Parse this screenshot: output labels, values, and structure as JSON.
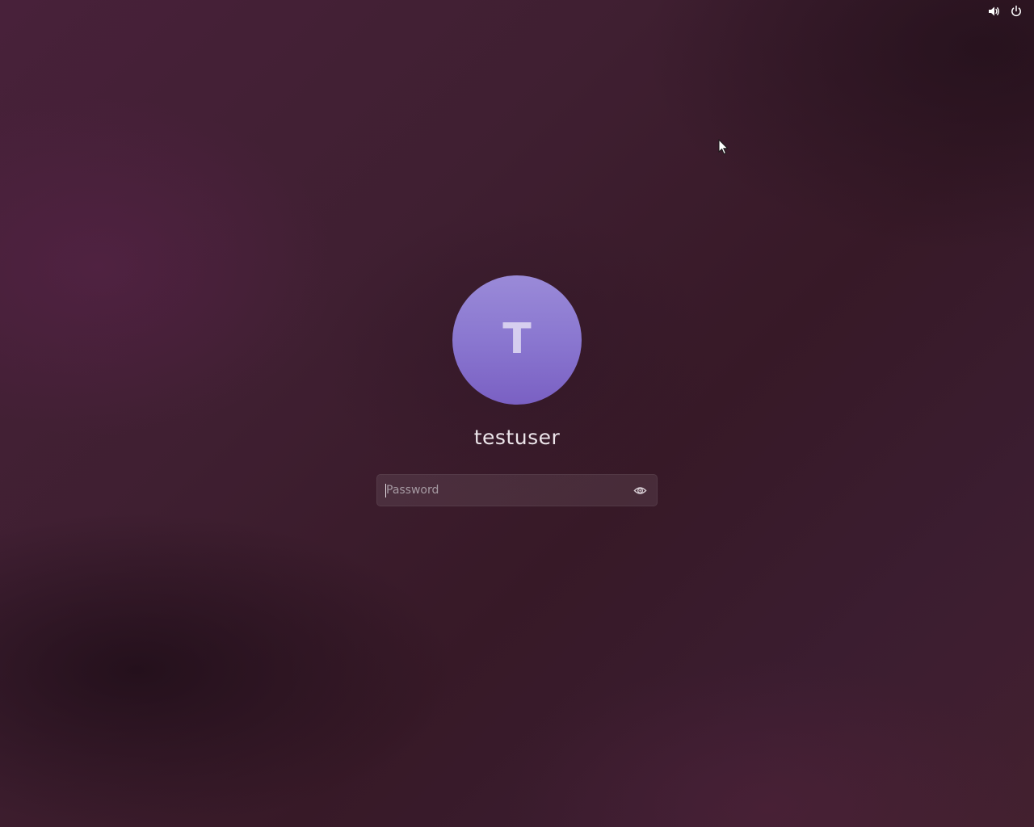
{
  "top_bar": {
    "volume_icon": "speaker-volume-icon",
    "power_icon": "power-icon"
  },
  "user": {
    "avatar_initial": "T",
    "username": "testuser",
    "avatar_color": "#8a77d0"
  },
  "password": {
    "placeholder": "Password",
    "value": "",
    "reveal_icon": "eye-icon"
  },
  "theme": {
    "background": "#3d1d30",
    "accent": "#7a60c3"
  }
}
